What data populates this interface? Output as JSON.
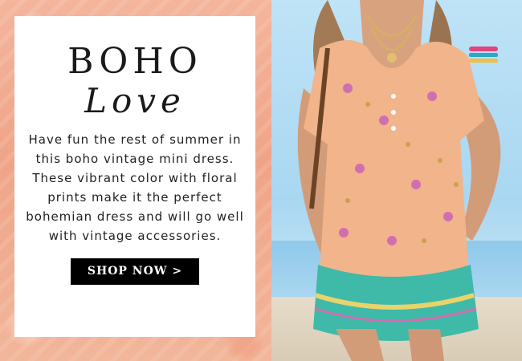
{
  "banner": {
    "title_line1": "BOHO",
    "title_line2": "Love",
    "description": "Have fun the rest of summer in this boho vintage mini dress. These vibrant color with floral prints make it the perfect bohemian dress and will go well with vintage accessories.",
    "cta_label": "SHOP NOW >"
  },
  "colors": {
    "background_pattern": "#efa487",
    "card": "#ffffff",
    "button": "#000000",
    "button_text": "#ffffff",
    "dress_base": "#f2b48a",
    "dress_hem": "#3fb9a8",
    "sky": "#bfe3f7"
  }
}
